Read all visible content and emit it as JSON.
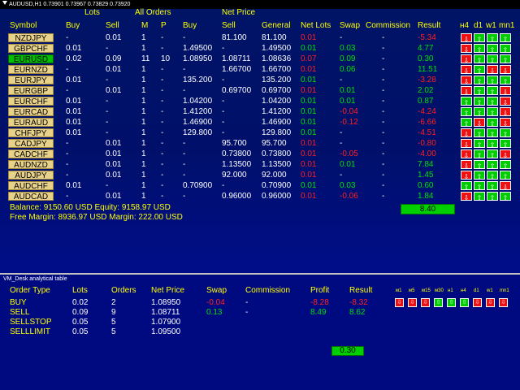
{
  "window": {
    "title": "AUDUSD,H1  0.73901 0.73967 0.73829 0.73920"
  },
  "header": {
    "group_labels": {
      "lots": "Lots",
      "all_orders": "All Orders",
      "net_price": "Net Price"
    },
    "columns": [
      "Symbol",
      "Buy",
      "Sell",
      "M",
      "P",
      "Buy",
      "Sell",
      "General",
      "Net Lots",
      "Swap",
      "Commission",
      "Result"
    ],
    "timeframes": [
      "н4",
      "d1",
      "w1",
      "mn1"
    ]
  },
  "rows": [
    {
      "symbol": "NZDJPY",
      "lots_buy": "-",
      "lots_sell": "0.01",
      "m": "1",
      "p": "-",
      "np_buy": "-",
      "np_sell": "81.100",
      "general": "81.100",
      "net_lots": "0.01",
      "net_lots_color": "red",
      "swap": "-",
      "swap_color": "white",
      "commission": "-",
      "result": "-5.34",
      "result_color": "red",
      "signals": [
        "dn",
        "up",
        "up",
        "up"
      ],
      "selected": false
    },
    {
      "symbol": "GBPCHF",
      "lots_buy": "0.01",
      "lots_sell": "-",
      "m": "1",
      "p": "-",
      "np_buy": "1.49500",
      "np_sell": "-",
      "general": "1.49500",
      "net_lots": "0.01",
      "net_lots_color": "green",
      "swap": "0.03",
      "swap_color": "green",
      "commission": "-",
      "result": "4.77",
      "result_color": "green",
      "signals": [
        "dn",
        "up",
        "up",
        "up"
      ],
      "selected": false
    },
    {
      "symbol": "EURUSD",
      "lots_buy": "0.02",
      "lots_sell": "0.09",
      "m": "11",
      "p": "10",
      "np_buy": "1.08950",
      "np_sell": "1.08711",
      "general": "1.08636",
      "net_lots": "0.07",
      "net_lots_color": "red",
      "swap": "0.09",
      "swap_color": "green",
      "commission": "-",
      "result": "0.30",
      "result_color": "green",
      "signals": [
        "dn",
        "up",
        "up",
        "up"
      ],
      "selected": true
    },
    {
      "symbol": "EURNZD",
      "lots_buy": "-",
      "lots_sell": "0.01",
      "m": "1",
      "p": "-",
      "np_buy": "-",
      "np_sell": "1.66700",
      "general": "1.66700",
      "net_lots": "0.01",
      "net_lots_color": "red",
      "swap": "0.06",
      "swap_color": "green",
      "commission": "-",
      "result": "11.51",
      "result_color": "green",
      "signals": [
        "dn",
        "up",
        "dn",
        "dn"
      ],
      "selected": false
    },
    {
      "symbol": "EURJPY",
      "lots_buy": "0.01",
      "lots_sell": "-",
      "m": "1",
      "p": "-",
      "np_buy": "135.200",
      "np_sell": "-",
      "general": "135.200",
      "net_lots": "0.01",
      "net_lots_color": "green",
      "swap": "-",
      "swap_color": "white",
      "commission": "-",
      "result": "-3.28",
      "result_color": "red",
      "signals": [
        "dn",
        "up",
        "up",
        "up"
      ],
      "selected": false
    },
    {
      "symbol": "EURGBP",
      "lots_buy": "-",
      "lots_sell": "0.01",
      "m": "1",
      "p": "-",
      "np_buy": "-",
      "np_sell": "0.69700",
      "general": "0.69700",
      "net_lots": "0.01",
      "net_lots_color": "red",
      "swap": "0.01",
      "swap_color": "green",
      "commission": "-",
      "result": "2.02",
      "result_color": "green",
      "signals": [
        "dn",
        "up",
        "up",
        "dn"
      ],
      "selected": false
    },
    {
      "symbol": "EURCHF",
      "lots_buy": "0.01",
      "lots_sell": "-",
      "m": "1",
      "p": "-",
      "np_buy": "1.04200",
      "np_sell": "-",
      "general": "1.04200",
      "net_lots": "0.01",
      "net_lots_color": "green",
      "swap": "0.01",
      "swap_color": "green",
      "commission": "-",
      "result": "0.87",
      "result_color": "green",
      "signals": [
        "up",
        "up",
        "up",
        "dn"
      ],
      "selected": false
    },
    {
      "symbol": "EURCAD",
      "lots_buy": "0.01",
      "lots_sell": "-",
      "m": "1",
      "p": "-",
      "np_buy": "1.41200",
      "np_sell": "-",
      "general": "1.41200",
      "net_lots": "0.01",
      "net_lots_color": "green",
      "swap": "-0.04",
      "swap_color": "red",
      "commission": "-",
      "result": "-4.24",
      "result_color": "red",
      "signals": [
        "up",
        "up",
        "up",
        "dn"
      ],
      "selected": false
    },
    {
      "symbol": "EURAUD",
      "lots_buy": "0.01",
      "lots_sell": "-",
      "m": "1",
      "p": "-",
      "np_buy": "1.46900",
      "np_sell": "-",
      "general": "1.46900",
      "net_lots": "0.01",
      "net_lots_color": "green",
      "swap": "-0.12",
      "swap_color": "red",
      "commission": "-",
      "result": "-6.66",
      "result_color": "red",
      "signals": [
        "up",
        "dn",
        "up",
        "dn"
      ],
      "selected": false
    },
    {
      "symbol": "CHFJPY",
      "lots_buy": "0.01",
      "lots_sell": "-",
      "m": "1",
      "p": "-",
      "np_buy": "129.800",
      "np_sell": "-",
      "general": "129.800",
      "net_lots": "0.01",
      "net_lots_color": "green",
      "swap": "-",
      "swap_color": "white",
      "commission": "-",
      "result": "-4.51",
      "result_color": "red",
      "signals": [
        "dn",
        "up",
        "up",
        "up"
      ],
      "selected": false
    },
    {
      "symbol": "CADJPY",
      "lots_buy": "-",
      "lots_sell": "0.01",
      "m": "1",
      "p": "-",
      "np_buy": "-",
      "np_sell": "95.700",
      "general": "95.700",
      "net_lots": "0.01",
      "net_lots_color": "red",
      "swap": "-",
      "swap_color": "white",
      "commission": "-",
      "result": "-0.80",
      "result_color": "red",
      "signals": [
        "dn",
        "up",
        "up",
        "up"
      ],
      "selected": false
    },
    {
      "symbol": "CADCHF",
      "lots_buy": "-",
      "lots_sell": "0.01",
      "m": "1",
      "p": "-",
      "np_buy": "-",
      "np_sell": "0.73800",
      "general": "0.73800",
      "net_lots": "0.01",
      "net_lots_color": "red",
      "swap": "-0.05",
      "swap_color": "red",
      "commission": "-",
      "result": "-4.00",
      "result_color": "red",
      "signals": [
        "dn",
        "up",
        "up",
        "dn"
      ],
      "selected": false
    },
    {
      "symbol": "AUDNZD",
      "lots_buy": "-",
      "lots_sell": "0.01",
      "m": "1",
      "p": "-",
      "np_buy": "-",
      "np_sell": "1.13500",
      "general": "1.13500",
      "net_lots": "0.01",
      "net_lots_color": "red",
      "swap": "0.01",
      "swap_color": "green",
      "commission": "-",
      "result": "7.84",
      "result_color": "green",
      "signals": [
        "dn",
        "up",
        "up",
        "up"
      ],
      "selected": false
    },
    {
      "symbol": "AUDJPY",
      "lots_buy": "-",
      "lots_sell": "0.01",
      "m": "1",
      "p": "-",
      "np_buy": "-",
      "np_sell": "92.000",
      "general": "92.000",
      "net_lots": "0.01",
      "net_lots_color": "red",
      "swap": "-",
      "swap_color": "white",
      "commission": "-",
      "result": "1.45",
      "result_color": "green",
      "signals": [
        "dn",
        "up",
        "up",
        "up"
      ],
      "selected": false
    },
    {
      "symbol": "AUDCHF",
      "lots_buy": "0.01",
      "lots_sell": "-",
      "m": "1",
      "p": "-",
      "np_buy": "0.70900",
      "np_sell": "-",
      "general": "0.70900",
      "net_lots": "0.01",
      "net_lots_color": "green",
      "swap": "0.03",
      "swap_color": "green",
      "commission": "-",
      "result": "0.60",
      "result_color": "green",
      "signals": [
        "up",
        "up",
        "up",
        "dn"
      ],
      "selected": false
    },
    {
      "symbol": "AUDCAD",
      "lots_buy": "-",
      "lots_sell": "0.01",
      "m": "1",
      "p": "-",
      "np_buy": "-",
      "np_sell": "0.96000",
      "general": "0.96000",
      "net_lots": "0.01",
      "net_lots_color": "red",
      "swap": "-0.06",
      "swap_color": "red",
      "commission": "-",
      "result": "1.84",
      "result_color": "green",
      "signals": [
        "dn",
        "up",
        "up",
        "up"
      ],
      "selected": false
    }
  ],
  "account": {
    "balance_line": "Balance: 9150.60 USD Equity: 9158.97 USD",
    "margin_line": "Free Margin: 8936.97 USD Margin: 222.00 USD",
    "total_result": "8.40"
  },
  "panel": {
    "title": "VM_Desk analytical table",
    "columns": [
      "Order Type",
      "Lots",
      "Orders",
      "Net Price",
      "Swap",
      "Commission",
      "Profit",
      "Result"
    ],
    "timeframes": [
      "м1",
      "м5",
      "м15",
      "м30",
      "н1",
      "н4",
      "d1",
      "w1",
      "mn1"
    ],
    "signals": [
      "dn",
      "dn",
      "dn",
      "up",
      "up",
      "up",
      "dn",
      "dn",
      "dn"
    ],
    "rows": [
      {
        "type": "BUY",
        "lots": "0.02",
        "orders": "2",
        "net_price": "1.08950",
        "swap": "-0.04",
        "swap_color": "red",
        "commission": "-",
        "profit": "-8.28",
        "profit_color": "red",
        "result": "-8.32",
        "result_color": "red"
      },
      {
        "type": "SELL",
        "lots": "0.09",
        "orders": "9",
        "net_price": "1.08711",
        "swap": "0.13",
        "swap_color": "green",
        "commission": "-",
        "profit": "8.49",
        "profit_color": "green",
        "result": "8.62",
        "result_color": "green"
      },
      {
        "type": "SELLSTOP",
        "lots": "0.05",
        "orders": "5",
        "net_price": "1.07900",
        "swap": "",
        "swap_color": "white",
        "commission": "",
        "profit": "",
        "profit_color": "white",
        "result": "",
        "result_color": "white"
      },
      {
        "type": "SELLLIMIT",
        "lots": "0.05",
        "orders": "5",
        "net_price": "1.09500",
        "swap": "",
        "swap_color": "white",
        "commission": "",
        "profit": "",
        "profit_color": "white",
        "result": "",
        "result_color": "white"
      }
    ],
    "total_result": "0.30"
  },
  "colors": {
    "background": "#001466",
    "header_text": "#ffff00",
    "positive": "#00e000",
    "negative": "#ff2020",
    "symbol_button": "#e8d28a",
    "symbol_selected": "#00c000"
  }
}
